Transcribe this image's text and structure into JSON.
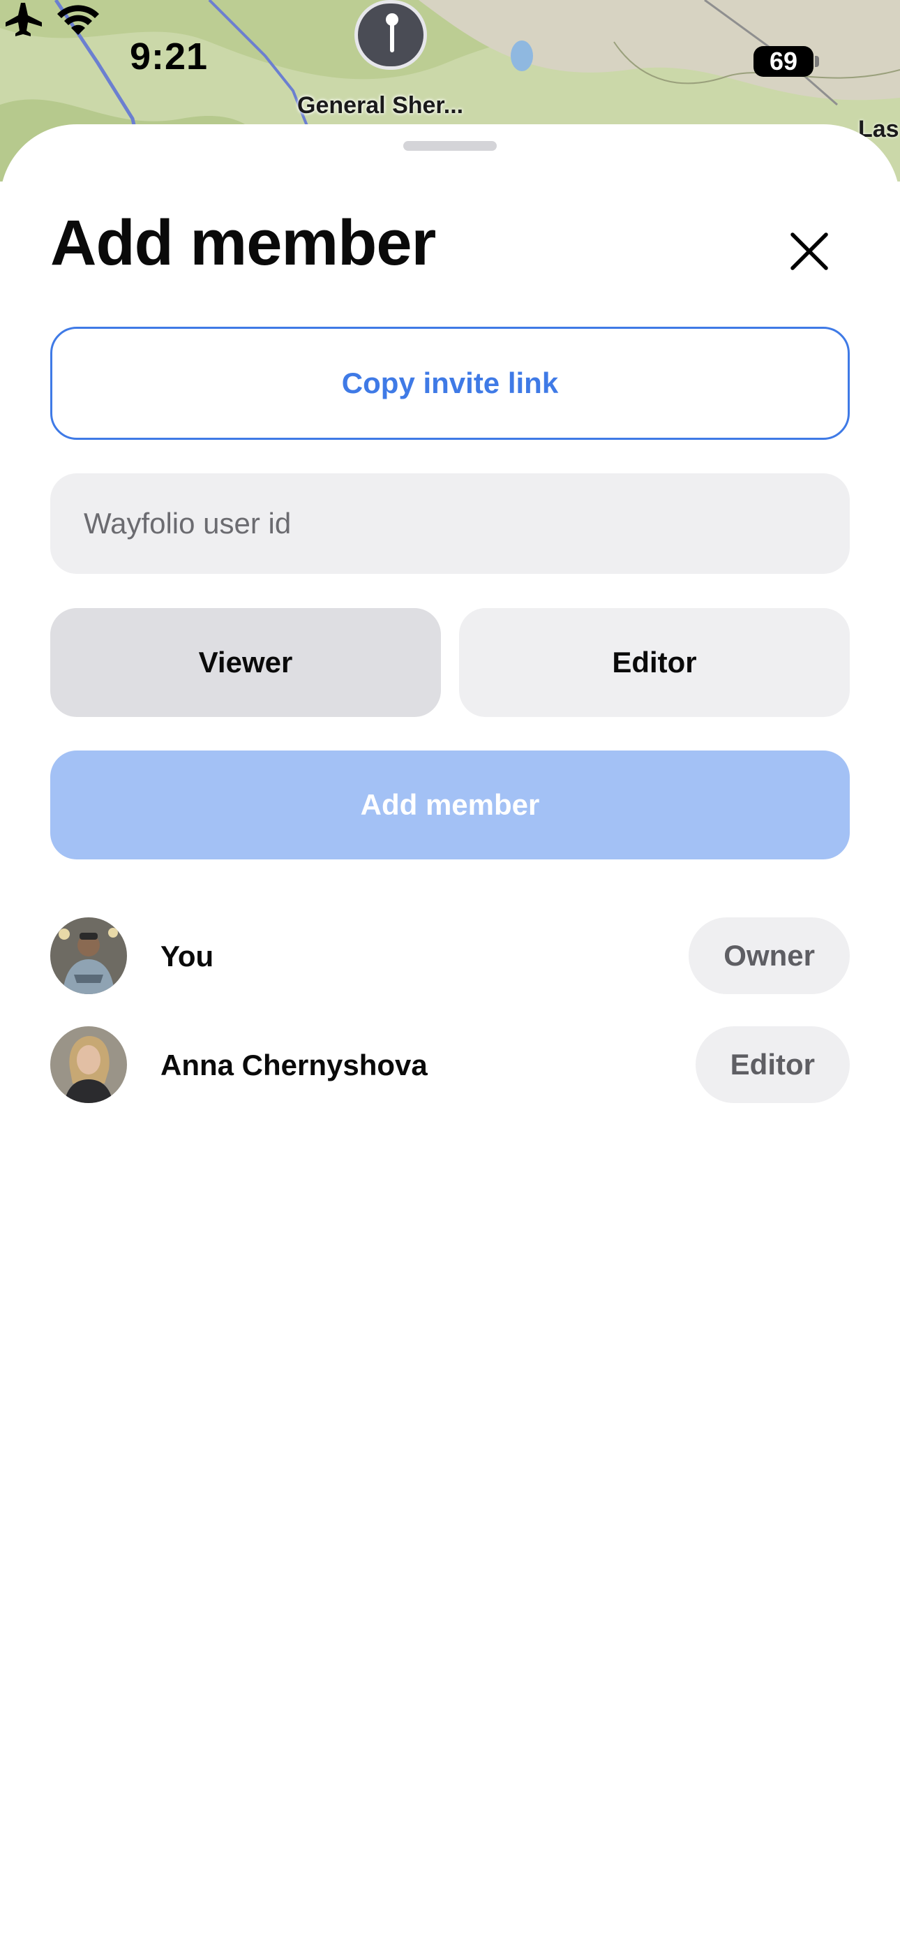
{
  "status_bar": {
    "time": "9:21",
    "battery": "69",
    "icons": [
      "airplane-icon",
      "wifi-icon",
      "battery-icon"
    ]
  },
  "map": {
    "labels": [
      "General Sher...",
      "Las"
    ]
  },
  "sheet": {
    "title": "Add member",
    "copy_invite_label": "Copy invite link",
    "user_id_placeholder": "Wayfolio user id",
    "roles": [
      "Viewer",
      "Editor"
    ],
    "selected_role": "Viewer",
    "add_member_label": "Add member",
    "members": [
      {
        "name": "You",
        "role": "Owner"
      },
      {
        "name": "Anna Chernyshova",
        "role": "Editor"
      }
    ]
  },
  "colors": {
    "accent": "#3f7ae6",
    "primary_disabled": "#a3c1f5",
    "field_bg": "#efeff1",
    "selected_segment": "#dedee2"
  }
}
